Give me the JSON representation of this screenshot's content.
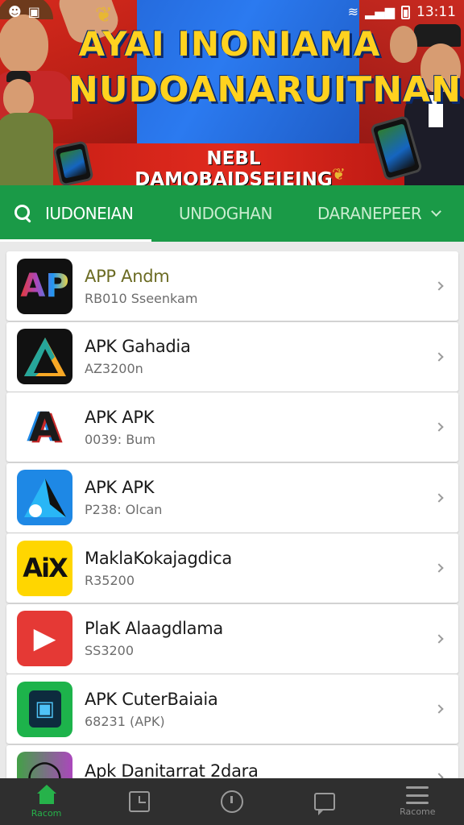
{
  "status_bar": {
    "time": "13:11",
    "left_icons": [
      "cat-icon",
      "notification-icon"
    ],
    "right_icons": [
      "wifi-icon",
      "signal-icon",
      "battery-icon"
    ]
  },
  "banner": {
    "title_line1": "AYAI INONIAMA",
    "title_line2": "NUDOANARUITNAN",
    "subtitle": "NEBL DAMOBAIDSEIEING AISTUN"
  },
  "tabs": [
    {
      "label": "IUDONEIAN",
      "active": true
    },
    {
      "label": "UNDOGHAN",
      "active": false
    },
    {
      "label": "DARANEPEER",
      "active": false
    }
  ],
  "apps": [
    {
      "name": "APP Andm",
      "sub": "RB010 Sseenkam",
      "icon": "ap-logo-icon",
      "icon_text": "AP",
      "icon_colors": [
        "#1a1a1a",
        "#e53935",
        "#2196f3"
      ]
    },
    {
      "name": "APK Gahadia",
      "sub": "AZ3200n",
      "icon": "triangle-logo-icon",
      "icon_text": "A",
      "icon_colors": [
        "#111111",
        "#f9a825",
        "#26a69a"
      ]
    },
    {
      "name": "APK APK",
      "sub": "0039: Bum",
      "icon": "a-logo-icon",
      "icon_text": "A",
      "icon_colors": [
        "#ffffff",
        "#c62828",
        "#1e88e5"
      ]
    },
    {
      "name": "APK APK",
      "sub": "P238: Olcan",
      "icon": "blue-a-logo-icon",
      "icon_text": "A",
      "icon_colors": [
        "#1e88e5",
        "#111111",
        "#ffffff"
      ]
    },
    {
      "name": "MaklaKokajagdica",
      "sub": "R35200",
      "icon": "aix-logo-icon",
      "icon_text": "AiX",
      "icon_colors": [
        "#ffd600",
        "#111111",
        "#111111"
      ]
    },
    {
      "name": "PlaK Alaagdlama",
      "sub": "SS3200",
      "icon": "play-logo-icon",
      "icon_text": "▶",
      "icon_colors": [
        "#e53935",
        "#ffffff",
        "#ffffff"
      ]
    },
    {
      "name": "APK CuterBaiaia",
      "sub": "68231 (APK)",
      "icon": "phone-logo-icon",
      "icon_text": "▣",
      "icon_colors": [
        "#1db34b",
        "#0d2b3e",
        "#4fc3f7"
      ]
    },
    {
      "name": "Apk Danitarrat 2dara",
      "sub": "",
      "icon": "circle-logo-icon",
      "icon_text": "◯",
      "icon_colors": [
        "#43a047",
        "#ab47bc",
        "#111111"
      ]
    }
  ],
  "bottom_nav": [
    {
      "label": "Racom",
      "icon": "home-icon",
      "active": true
    },
    {
      "label": "",
      "icon": "tablet-icon",
      "active": false
    },
    {
      "label": "",
      "icon": "clock-icon",
      "active": false
    },
    {
      "label": "",
      "icon": "chat-icon",
      "active": false
    },
    {
      "label": "Racome",
      "icon": "menu-icon",
      "active": false
    }
  ],
  "colors": {
    "accent_green": "#1a9a47",
    "banner_blue": "#2b7af0",
    "banner_red": "#c41d14",
    "title_yellow": "#ffd21f",
    "nav_bg": "#2f2f2f"
  }
}
